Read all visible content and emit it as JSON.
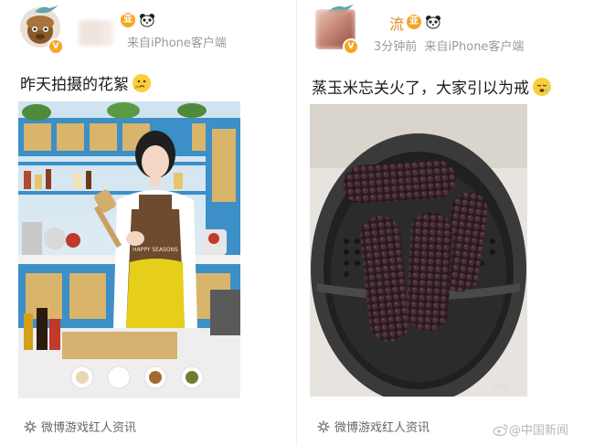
{
  "left_post": {
    "meta": "来自iPhone客户端",
    "text": "昨天拍摄的花絮",
    "emoji": "thinking-face-icon",
    "source": "微博游戏红人资讯",
    "photo_apron_text": "HAPPY SEASONS"
  },
  "right_post": {
    "username_fragment": "流",
    "meta_time": "3分钟前",
    "meta_client": "来自iPhone客户端",
    "text": "蒸玉米忘关火了，大家引以为戒",
    "emoji": "sleepy-face-icon",
    "source": "微博游戏红人资讯",
    "photo_watermark": "微博"
  },
  "page_watermark": "@中国新闻",
  "colors": {
    "verified": "#f6a623",
    "meta": "#9a9a9a",
    "apron_yellow": "#e6cf1a",
    "kitchen_blue": "#3c8fc7"
  }
}
